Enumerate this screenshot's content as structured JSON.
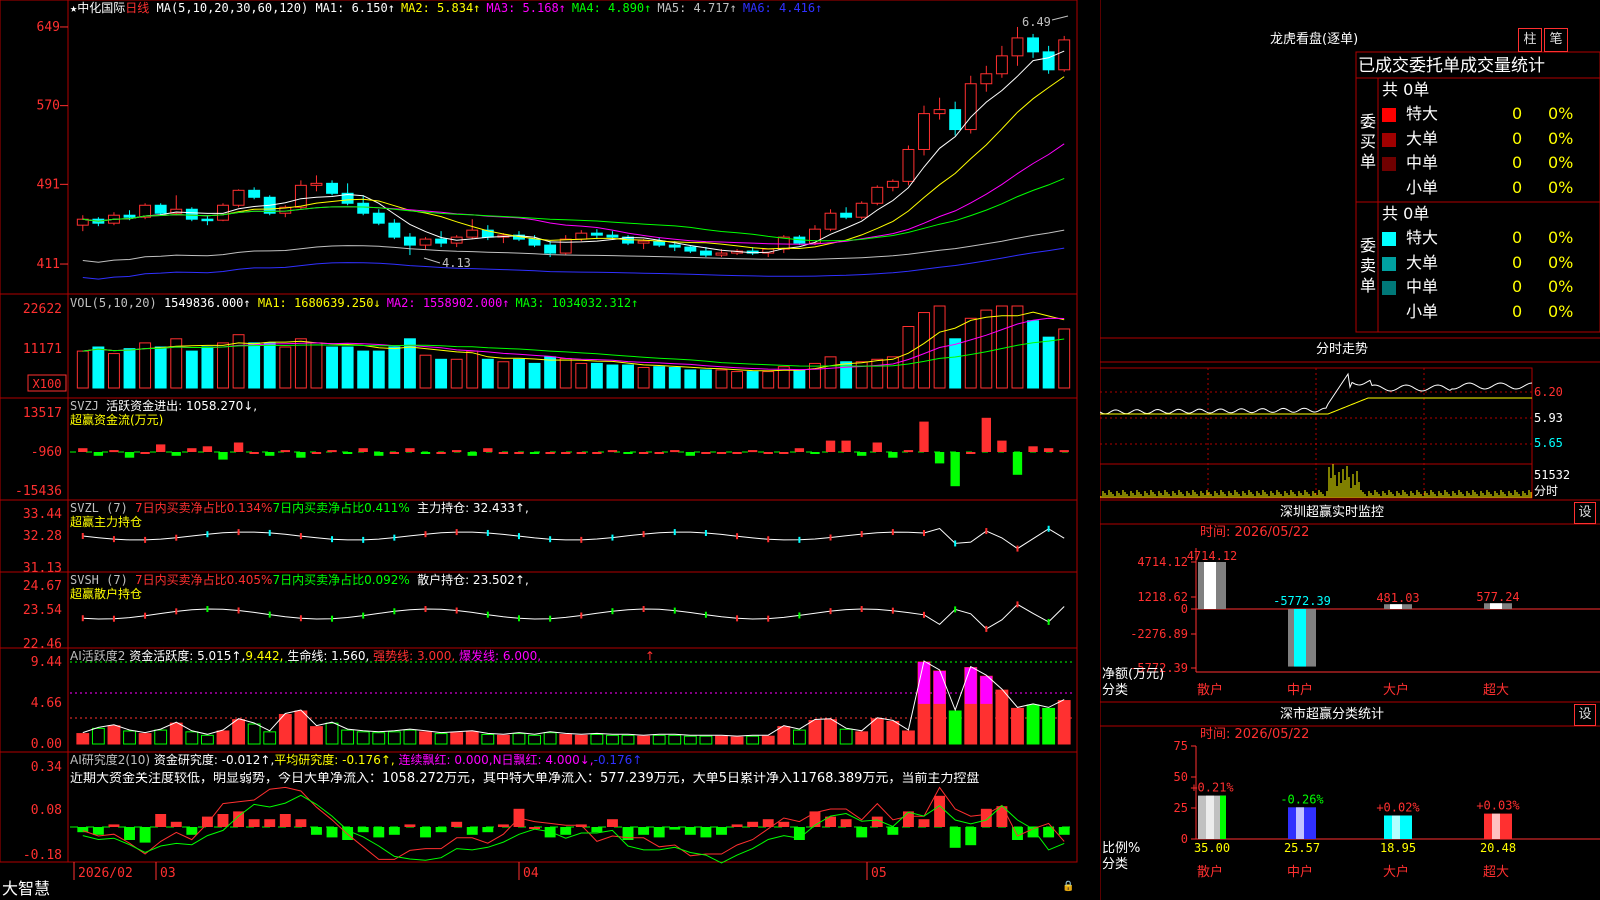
{
  "app": {
    "brand": "大智慧"
  },
  "stock": {
    "name": "中化国际",
    "period": "日线",
    "star": "★",
    "ma_label": "MA(5,10,20,30,60,120)",
    "ma_values": [
      {
        "label": "MA1: 6.150↑",
        "color": "#ffffff"
      },
      {
        "label": "MA2: 5.834↑",
        "color": "#ffff00"
      },
      {
        "label": "MA3: 5.168↑",
        "color": "#ff00ff"
      },
      {
        "label": "MA4: 4.890↑",
        "color": "#00ff00"
      },
      {
        "label": "MA5: 4.717↑",
        "color": "#c0c0c0"
      },
      {
        "label": "MA6: 4.416↑",
        "color": "#3030ff"
      }
    ],
    "high_label": "6.49",
    "low_label": "4.13",
    "y_ticks": [
      "649",
      "570",
      "491",
      "411"
    ]
  },
  "volume": {
    "header": "VOL(5,10,20)",
    "value": "1549836.000↑",
    "ma": [
      {
        "label": "MA1: 1680639.250↓",
        "color": "#ffff00"
      },
      {
        "label": "MA2: 1558902.000↑",
        "color": "#ff00ff"
      },
      {
        "label": "MA3: 1034032.312↑",
        "color": "#00ff00"
      }
    ],
    "y_ticks": [
      "22622",
      "11171"
    ],
    "unit_label": "X100"
  },
  "svzj": {
    "header": "SVZJ",
    "item": "活跃资金进出: 1058.270↓,",
    "title": "超赢资金流(万元)",
    "y_ticks": [
      "13517",
      "-960",
      "-15436"
    ]
  },
  "svzl": {
    "header": "SVZL (7)",
    "item1": "7日内买卖净占比0.134%",
    "item2": "7日内买卖净占比0.411%",
    "item3": "主力持仓: 32.433↑,",
    "title": "超赢主力持仓",
    "y_ticks": [
      "33.44",
      "32.28",
      "31.13"
    ]
  },
  "svsh": {
    "header": "SVSH (7)",
    "item1": "7日内买卖净占比0.405%",
    "item2": "7日内买卖净占比0.092%",
    "item3": "散户持仓: 23.502↑,",
    "title": "超赢散户持仓",
    "y_ticks": [
      "24.67",
      "23.54",
      "22.46"
    ]
  },
  "ai_active": {
    "header": "AI活跃度2",
    "item1": "资金活跃度: 5.015↑,",
    "item2": "9.442,",
    "item3": "生命线: 1.560,",
    "item4": "强势线: 3.000,",
    "item5": "爆发线: 6.000,",
    "item6": "↑",
    "y_ticks": [
      "9.44",
      "4.66",
      "0.00"
    ]
  },
  "ai_research": {
    "header": "AI研究度2(10)",
    "item1": "资金研究度: -0.012↑,",
    "item2": "平均研究度: -0.176↑,",
    "item3": "连续飘红: 0.000,",
    "item4": "N日飘红: 4.000↓,",
    "item5": "-0.176↑",
    "commentary": "近期大资金关注度较低，明显弱势，今日大单净流入：1058.272万元，其中特大单净流入：577.239万元，大单5日累计净入11768.389万元，当前主力控盘",
    "y_ticks": [
      "0.34",
      "0.08",
      "-0.18"
    ]
  },
  "x_axis": {
    "labels": [
      "2026/02",
      "03",
      "04",
      "05"
    ]
  },
  "dragon": {
    "title": "龙虎看盘(逐单)",
    "btn1": "柱",
    "btn2": "笔",
    "subtitle": "已成交委托单成交量统计",
    "buy_label": "委买单",
    "sell_label": "委卖单",
    "buy_total": "共 0单",
    "sell_total": "共 0单",
    "buy_rows": [
      {
        "name": "特大",
        "count": "0",
        "pct": "0%",
        "color": "#ff0000"
      },
      {
        "name": "大单",
        "count": "0",
        "pct": "0%",
        "color": "#a00000"
      },
      {
        "name": "中单",
        "count": "0",
        "pct": "0%",
        "color": "#700000"
      },
      {
        "name": "小单",
        "count": "0",
        "pct": "0%",
        "color": ""
      }
    ],
    "sell_rows": [
      {
        "name": "特大",
        "count": "0",
        "pct": "0%",
        "color": "#00ffff"
      },
      {
        "name": "大单",
        "count": "0",
        "pct": "0%",
        "color": "#00a0a0"
      },
      {
        "name": "中单",
        "count": "0",
        "pct": "0%",
        "color": "#007878"
      },
      {
        "name": "小单",
        "count": "0",
        "pct": "0%",
        "color": ""
      }
    ]
  },
  "intraday": {
    "title": "分时走势",
    "y_ticks": [
      "6.20",
      "5.93",
      "5.65"
    ],
    "vol_tick": "51532",
    "unit": "分时"
  },
  "sz_monitor": {
    "title": "深圳超赢实时监控",
    "btn": "设",
    "time_label": "时间: 2026/05/22",
    "y_ticks": [
      "4714.12",
      "1218.62",
      "0",
      "-2276.89",
      "-5772.39"
    ],
    "y_label": "净额(万元)",
    "x_label": "分类",
    "cats": [
      "散户",
      "中户",
      "大户",
      "超大"
    ],
    "values": [
      4714.12,
      -5772.39,
      481.03,
      577.24
    ],
    "value_labels": [
      "4714.12",
      "-5772.39",
      "481.03",
      "577.24"
    ],
    "colors": [
      "#ffffff",
      "#00ffff",
      "#ffffff",
      "#ffffff"
    ]
  },
  "sz_class": {
    "title": "深市超赢分类统计",
    "btn": "设",
    "time_label": "时间: 2026/05/22",
    "y_ticks": [
      "75",
      "50",
      "25",
      "0"
    ],
    "y_label": "比例%",
    "x_label": "分类",
    "cats": [
      "散户",
      "中户",
      "大户",
      "超大"
    ],
    "values": [
      35.0,
      25.57,
      18.95,
      20.48
    ],
    "value_labels": [
      "35.00",
      "25.57",
      "18.95",
      "20.48"
    ],
    "change_labels": [
      "+0.21%",
      "-0.26%",
      "+0.02%",
      "+0.03%"
    ],
    "colors": [
      "#c0c0c0",
      "#3030ff",
      "#00ffff",
      "#ff3030"
    ]
  },
  "chart_data": [
    {
      "type": "candlestick",
      "categories": [
        "2026/02",
        "03",
        "04",
        "05"
      ],
      "ohlc": [
        [
          4.5,
          4.6,
          4.44,
          4.56
        ],
        [
          4.56,
          4.58,
          4.49,
          4.52
        ],
        [
          4.52,
          4.63,
          4.5,
          4.6
        ],
        [
          4.6,
          4.65,
          4.55,
          4.58
        ],
        [
          4.58,
          4.72,
          4.56,
          4.7
        ],
        [
          4.7,
          4.72,
          4.6,
          4.62
        ],
        [
          4.62,
          4.8,
          4.6,
          4.66
        ],
        [
          4.66,
          4.68,
          4.54,
          4.56
        ],
        [
          4.56,
          4.6,
          4.5,
          4.55
        ],
        [
          4.55,
          4.72,
          4.54,
          4.7
        ],
        [
          4.7,
          4.86,
          4.68,
          4.85
        ],
        [
          4.85,
          4.88,
          4.76,
          4.78
        ],
        [
          4.78,
          4.8,
          4.6,
          4.62
        ],
        [
          4.62,
          4.7,
          4.58,
          4.68
        ],
        [
          4.68,
          4.95,
          4.66,
          4.9
        ],
        [
          4.9,
          5.0,
          4.84,
          4.92
        ],
        [
          4.92,
          4.95,
          4.8,
          4.82
        ],
        [
          4.82,
          4.92,
          4.7,
          4.72
        ],
        [
          4.72,
          4.8,
          4.6,
          4.62
        ],
        [
          4.62,
          4.66,
          4.5,
          4.52
        ],
        [
          4.52,
          4.56,
          4.36,
          4.38
        ],
        [
          4.38,
          4.42,
          4.2,
          4.3
        ],
        [
          4.3,
          4.38,
          4.26,
          4.36
        ],
        [
          4.36,
          4.44,
          4.28,
          4.32
        ],
        [
          4.32,
          4.4,
          4.28,
          4.38
        ],
        [
          4.38,
          4.56,
          4.36,
          4.45
        ],
        [
          4.45,
          4.5,
          4.35,
          4.38
        ],
        [
          4.38,
          4.42,
          4.32,
          4.4
        ],
        [
          4.4,
          4.44,
          4.34,
          4.36
        ],
        [
          4.36,
          4.4,
          4.28,
          4.3
        ],
        [
          4.3,
          4.34,
          4.18,
          4.22
        ],
        [
          4.22,
          4.4,
          4.2,
          4.36
        ],
        [
          4.36,
          4.45,
          4.34,
          4.42
        ],
        [
          4.42,
          4.46,
          4.36,
          4.4
        ],
        [
          4.4,
          4.44,
          4.36,
          4.38
        ],
        [
          4.38,
          4.4,
          4.3,
          4.32
        ],
        [
          4.32,
          4.36,
          4.26,
          4.34
        ],
        [
          4.34,
          4.38,
          4.28,
          4.3
        ],
        [
          4.3,
          4.34,
          4.24,
          4.28
        ],
        [
          4.28,
          4.3,
          4.22,
          4.24
        ],
        [
          4.24,
          4.28,
          4.18,
          4.2
        ],
        [
          4.2,
          4.26,
          4.18,
          4.22
        ],
        [
          4.22,
          4.26,
          4.2,
          4.24
        ],
        [
          4.24,
          4.28,
          4.2,
          4.22
        ],
        [
          4.22,
          4.26,
          4.18,
          4.26
        ],
        [
          4.26,
          4.4,
          4.22,
          4.38
        ],
        [
          4.38,
          4.4,
          4.3,
          4.32
        ],
        [
          4.32,
          4.5,
          4.3,
          4.46
        ],
        [
          4.46,
          4.66,
          4.44,
          4.62
        ],
        [
          4.62,
          4.68,
          4.56,
          4.58
        ],
        [
          4.58,
          4.74,
          4.56,
          4.72
        ],
        [
          4.72,
          4.9,
          4.7,
          4.88
        ],
        [
          4.88,
          4.96,
          4.84,
          4.94
        ],
        [
          4.94,
          5.3,
          4.9,
          5.26
        ],
        [
          5.26,
          5.7,
          5.2,
          5.62
        ],
        [
          5.62,
          5.78,
          5.56,
          5.66
        ],
        [
          5.66,
          5.74,
          5.4,
          5.46
        ],
        [
          5.46,
          6.0,
          5.42,
          5.92
        ],
        [
          5.92,
          6.1,
          5.84,
          6.02
        ],
        [
          6.02,
          6.3,
          5.98,
          6.2
        ],
        [
          6.2,
          6.49,
          6.1,
          6.38
        ],
        [
          6.38,
          6.42,
          6.18,
          6.24
        ],
        [
          6.24,
          6.3,
          6.02,
          6.06
        ],
        [
          6.06,
          6.4,
          6.04,
          6.36
        ]
      ]
    }
  ]
}
